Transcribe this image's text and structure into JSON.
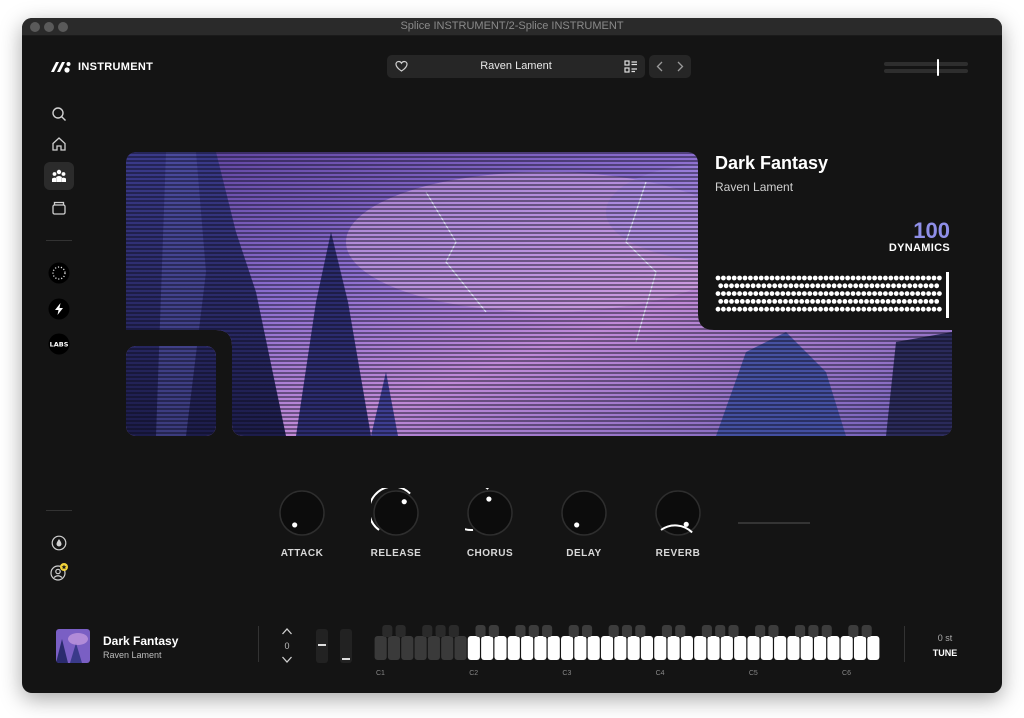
{
  "window": {
    "title": "Splice INSTRUMENT/2-Splice INSTRUMENT"
  },
  "brand": {
    "name": "INSTRUMENT",
    "icon": "instrument-logo"
  },
  "header": {
    "preset_name": "Raven Lament",
    "favorite_icon": "heart-icon",
    "browse_icon": "list-grid-icon",
    "prev_icon": "chevron-left-icon",
    "next_icon": "chevron-right-icon",
    "volume_level": 0.64
  },
  "sidebar": {
    "items": [
      {
        "name": "search",
        "icon": "search-icon",
        "active": false
      },
      {
        "name": "home",
        "icon": "home-icon",
        "active": false
      },
      {
        "name": "community",
        "icon": "users-icon",
        "active": true
      },
      {
        "name": "library",
        "icon": "box-icon",
        "active": false
      }
    ],
    "packs": [
      {
        "name": "pack-dots",
        "icon": "dotted-circle-icon"
      },
      {
        "name": "pack-bolt",
        "icon": "bolt-icon"
      },
      {
        "name": "pack-labs",
        "icon": "labs-icon",
        "label": "LABS"
      }
    ],
    "bottom": [
      {
        "name": "drop",
        "icon": "drop-icon"
      },
      {
        "name": "account",
        "icon": "user-star-icon"
      }
    ]
  },
  "instrument": {
    "title": "Dark Fantasy",
    "subtitle": "Raven Lament",
    "dynamics_value": "100",
    "dynamics_label": "DYNAMICS"
  },
  "knobs": [
    {
      "label": "ATTACK",
      "value": 0.05
    },
    {
      "label": "RELEASE",
      "value": 0.7
    },
    {
      "label": "CHORUS",
      "value": 0.85
    },
    {
      "label": "DELAY",
      "value": 0.05
    },
    {
      "label": "REVERB",
      "value": 0.3
    }
  ],
  "footer": {
    "title": "Dark Fantasy",
    "subtitle": "Raven Lament",
    "octave_value": "0",
    "tune_value": "0 st",
    "tune_label": "TUNE",
    "keyboard_labels": [
      "C1",
      "C2",
      "C3",
      "C4",
      "C5",
      "C6"
    ]
  },
  "colors": {
    "background": "#141414",
    "panel": "#262626",
    "accent": "#8f8fe8",
    "text": "#ffffff"
  }
}
